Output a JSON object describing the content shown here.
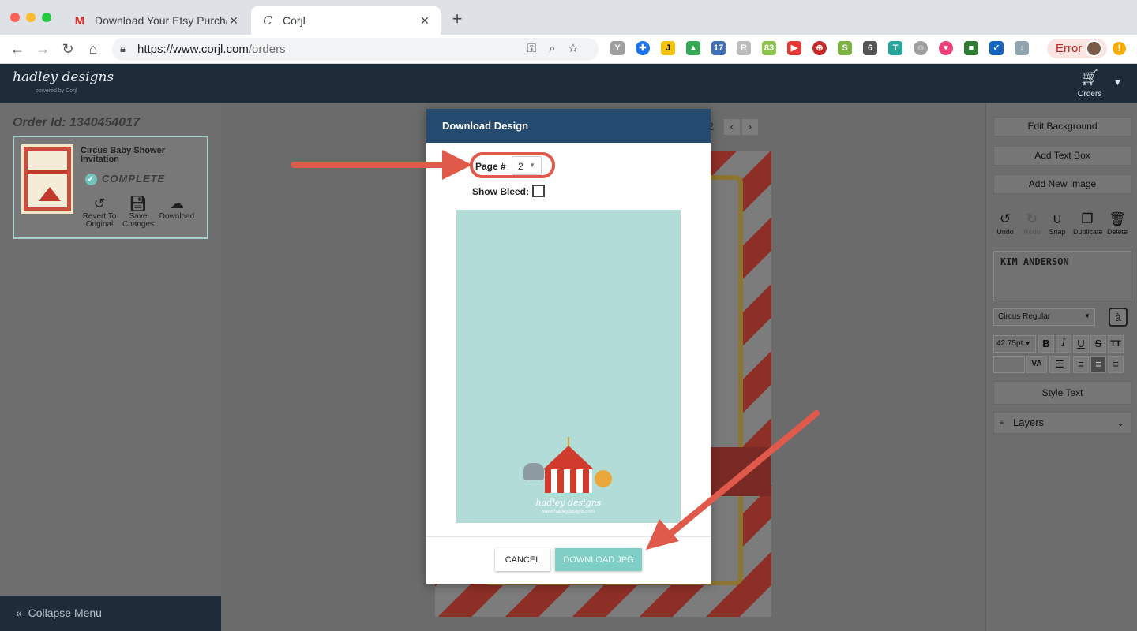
{
  "browser": {
    "tabs": [
      {
        "icon": "gmail-icon",
        "title": "Download Your Etsy Purchase f",
        "active": false
      },
      {
        "icon": "corjl-icon",
        "title": "Corjl",
        "active": true
      }
    ],
    "url_host": "https://www.corjl.com",
    "url_path": "/orders",
    "extension_badges": {
      "badge_17": "17",
      "badge_83": "83",
      "badge_6": "6"
    },
    "profile_status": "Error"
  },
  "header": {
    "brand": "hadley designs",
    "brand_sub": "powered by Corjl",
    "orders_label": "Orders"
  },
  "left_panel": {
    "order_id": "Order Id: 1340454017",
    "card": {
      "title": "Circus Baby Shower Invitation",
      "status": "COMPLETE",
      "actions": {
        "revert": "Revert To Original",
        "save": "Save Changes",
        "download": "Download"
      }
    },
    "collapse_label": "Collapse Menu"
  },
  "canvas": {
    "page_indicator": "2"
  },
  "right_panel": {
    "edit_background": "Edit Background",
    "add_text_box": "Add Text Box",
    "add_new_image": "Add New Image",
    "tools": {
      "undo": "Undo",
      "redo": "Redo",
      "snap": "Snap",
      "duplicate": "Duplicate",
      "delete": "Delete"
    },
    "text_value": "KIM ANDERSON",
    "font": "Circus Regular",
    "font_size": "42.75pt",
    "style_text": "Style Text",
    "layers": "Layers"
  },
  "modal": {
    "title": "Download Design",
    "page_label": "Page #",
    "page_value": "2",
    "show_bleed_label": "Show Bleed:",
    "show_bleed_checked": false,
    "preview_brand": "hadley designs",
    "preview_url": "www.hadleydesigns.com",
    "cancel": "CANCEL",
    "download": "DOWNLOAD JPG"
  },
  "colors": {
    "header_bg": "#1e2b38",
    "modal_header": "#244a70",
    "accent_teal": "#7fcfc6",
    "annotation_red": "#e05a4c"
  }
}
